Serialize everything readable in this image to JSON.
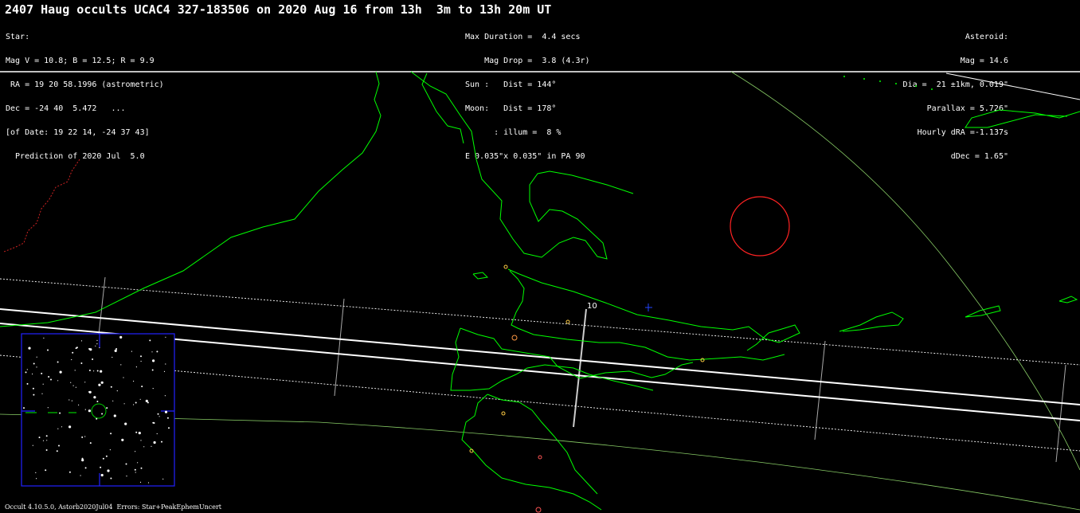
{
  "header": {
    "title": "2407 Haug occults UCAC4 327-183506 on 2020 Aug 16 from 13h  3m to 13h 20m UT"
  },
  "star_info": [
    "Star:",
    "Mag V = 10.8; B = 12.5; R = 9.9",
    " RA = 19 20 58.1996 (astrometric)",
    "Dec = -24 40  5.472   ...",
    "[of Date: 19 22 14, -24 37 43]",
    "  Prediction of 2020 Jul  5.0"
  ],
  "event_info": [
    "Max Duration =  4.4 secs",
    "    Mag Drop =  3.8 (4.3r)",
    "Sun :   Dist = 144°",
    "Moon:   Dist = 178°",
    "      : illum =  8 %",
    "E 0.035\"x 0.035\" in PA 90"
  ],
  "asteroid_info": [
    "Asteroid:",
    "Mag = 14.6",
    "Dia =  21 ±1km, 0.019\"",
    "Parallax = 5.726\"",
    "Hourly dRA =-1.137s",
    "dDec = 1.65\""
  ],
  "map": {
    "track_minute_label": "10",
    "colors": {
      "coastline": "#00ff00",
      "grid": "#88cc66",
      "path_center": "#ffffff",
      "border_dotted": "#cc2222",
      "sun_circle": "#ff2222",
      "finder_frame": "#2222ff",
      "marker": "#2244ff"
    }
  },
  "footer": {
    "text": "Occult 4.10.5.0, Astorb2020Jul04  Errors: Star+PeakEphemUncert"
  }
}
